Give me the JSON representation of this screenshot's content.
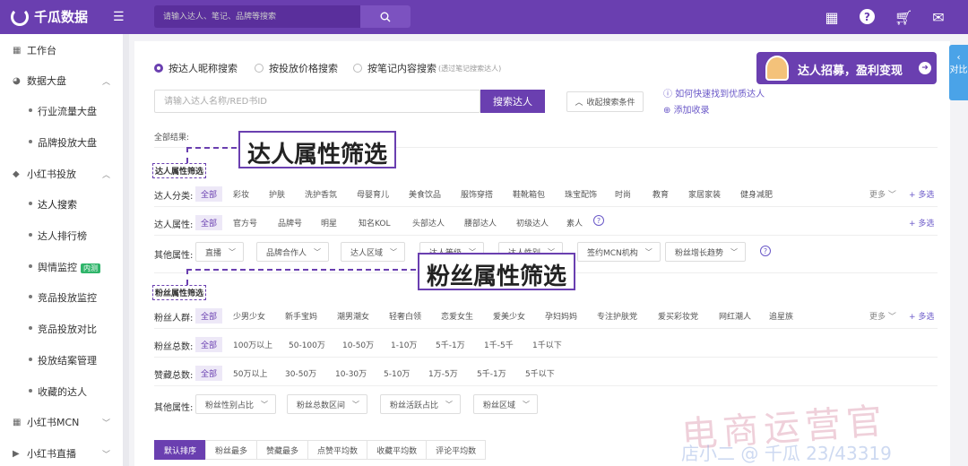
{
  "topbar": {
    "brand": "千瓜数据",
    "search_placeholder": "请输入达人、笔记、品牌等搜索",
    "icons": [
      "grid-icon",
      "help-icon",
      "cart-icon",
      "mail-icon"
    ]
  },
  "sidebar": {
    "items": [
      {
        "label": "工作台",
        "level": 0
      },
      {
        "label": "数据大盘",
        "level": 0,
        "chevron": "︿"
      },
      {
        "label": "行业流量大盘",
        "level": 1
      },
      {
        "label": "品牌投放大盘",
        "level": 1
      },
      {
        "label": "小红书投放",
        "level": 0,
        "chevron": "︿"
      },
      {
        "label": "达人搜索",
        "level": 1
      },
      {
        "label": "达人排行榜",
        "level": 1
      },
      {
        "label": "舆情监控",
        "level": 1,
        "badge": "内测"
      },
      {
        "label": "竞品投放监控",
        "level": 1
      },
      {
        "label": "竞品投放对比",
        "level": 1
      },
      {
        "label": "投放结案管理",
        "level": 1
      },
      {
        "label": "收藏的达人",
        "level": 1
      },
      {
        "label": "小红书MCN",
        "level": 0,
        "chevron": "﹀"
      },
      {
        "label": "小红书直播",
        "level": 0,
        "chevron": "﹀"
      }
    ]
  },
  "search_modes": [
    {
      "label": "按达人昵称搜索",
      "selected": true,
      "note": ""
    },
    {
      "label": "按投放价格搜索",
      "selected": false,
      "note": ""
    },
    {
      "label": "按笔记内容搜索",
      "selected": false,
      "note": "(透过笔记搜索达人)"
    }
  ],
  "banner": {
    "text": "达人招募，盈利变现",
    "go": "➜"
  },
  "keyword": {
    "placeholder": "请输入达人名称/RED书ID",
    "button": "搜索达人",
    "collapse": "收起搜索条件"
  },
  "help_links": [
    "如何快速找到优质达人",
    "添加收录"
  ],
  "all_results": "全部结果:",
  "section_labels": {
    "influencer": "达人属性筛选",
    "fans": "粉丝属性筛选"
  },
  "callouts": {
    "influencer": "达人属性筛选",
    "fans": "粉丝属性筛选"
  },
  "rows": {
    "category": {
      "title": "达人分类:",
      "options": [
        "全部",
        "彩妆",
        "护肤",
        "洗护香氛",
        "母婴育儿",
        "美食饮品",
        "服饰穿搭",
        "鞋靴箱包",
        "珠宝配饰",
        "时尚",
        "教育",
        "家居家装",
        "健身减肥"
      ],
      "more": "更多 ﹀",
      "multi": "+ 多选"
    },
    "attr": {
      "title": "达人属性:",
      "options": [
        "全部",
        "官方号",
        "品牌号",
        "明星",
        "知名KOL",
        "头部达人",
        "腰部达人",
        "初级达人",
        "素人"
      ],
      "multi": "+ 多选"
    },
    "other1": {
      "title": "其他属性:",
      "dropdowns": [
        "直播",
        "品牌合作人",
        "达人区域",
        "达人等级",
        "达人性别",
        "签约MCN机构",
        "粉丝增长趋势"
      ]
    },
    "fans_crowd": {
      "title": "粉丝人群:",
      "options": [
        "全部",
        "少男少女",
        "新手宝妈",
        "潮男潮女",
        "轻奢白领",
        "恋爱女生",
        "爱美少女",
        "孕妇妈妈",
        "专注护肤党",
        "爱买彩妆党",
        "网红潮人",
        "追星族"
      ],
      "more": "更多 ﹀",
      "multi": "+ 多选"
    },
    "fans_total": {
      "title": "粉丝总数:",
      "options": [
        "全部",
        "100万以上",
        "50-100万",
        "10-50万",
        "1-10万",
        "5千-1万",
        "1千-5千",
        "1千以下"
      ]
    },
    "likes_total": {
      "title": "赞藏总数:",
      "options": [
        "全部",
        "50万以上",
        "30-50万",
        "10-30万",
        "5-10万",
        "1万-5万",
        "5千-1万",
        "5千以下"
      ]
    },
    "other2": {
      "title": "其他属性:",
      "dropdowns": [
        "粉丝性别占比",
        "粉丝总数区间",
        "粉丝活跃占比",
        "粉丝区域"
      ]
    }
  },
  "sort_tabs": [
    "默认排序",
    "粉丝最多",
    "赞藏最多",
    "点赞平均数",
    "收藏平均数",
    "评论平均数"
  ],
  "compare_tab": "对比",
  "watermark": "电商运营官",
  "watermark_sub": "店小二 @ 千瓜 23/43319"
}
